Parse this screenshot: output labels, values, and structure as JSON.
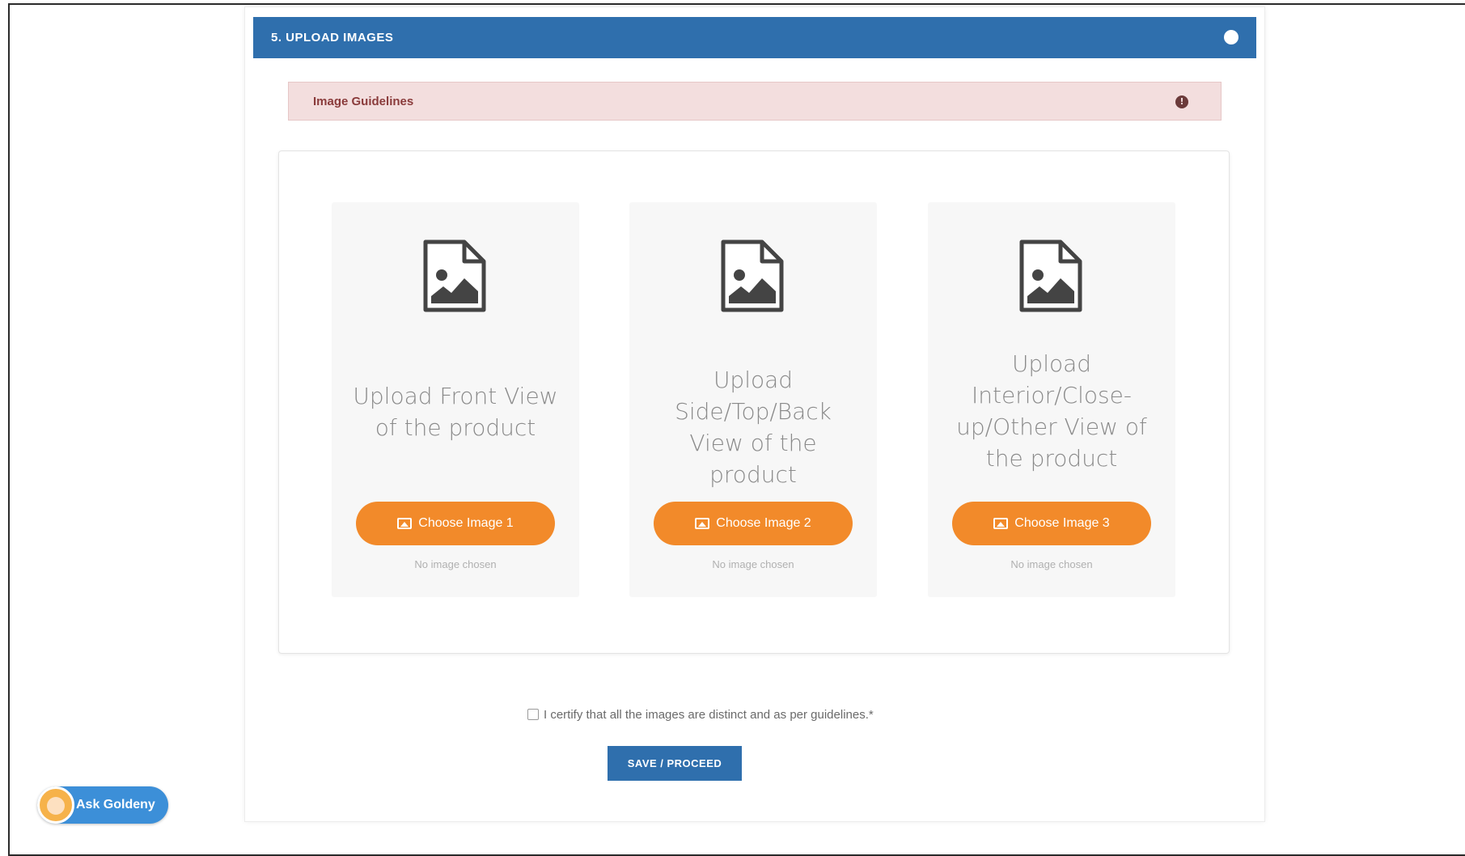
{
  "section": {
    "title": "5. UPLOAD IMAGES"
  },
  "guidelines": {
    "title": "Image Guidelines",
    "info_symbol": "!"
  },
  "cards": [
    {
      "label": "Upload Front View of the product",
      "button": "Choose Image 1",
      "status": "No image chosen"
    },
    {
      "label": "Upload Side/Top/Back View of the product",
      "button": "Choose Image 2",
      "status": "No image chosen"
    },
    {
      "label": "Upload Interior/Close-up/Other View of the product",
      "button": "Choose Image 3",
      "status": "No image chosen"
    }
  ],
  "certify": {
    "text": "I certify that all the images are distinct and as per guidelines.*"
  },
  "actions": {
    "save_label": "SAVE / PROCEED"
  },
  "assistant": {
    "label": "Ask Goldeny"
  },
  "colors": {
    "header_blue": "#2f6fad",
    "guideline_bg": "#f3dede",
    "button_orange": "#f28a2a",
    "assistant_blue": "#3c8fd8"
  }
}
